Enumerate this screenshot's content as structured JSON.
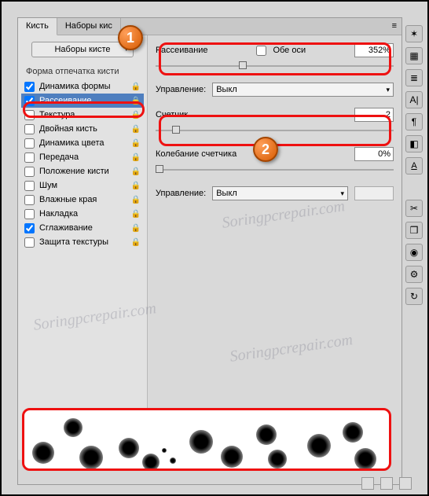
{
  "tabs": {
    "brush": "Кисть",
    "presets": "Наборы кис"
  },
  "presets_btn": "Наборы кисте",
  "section_title": "Форма отпечатка кисти",
  "options": [
    {
      "label": "Динамика формы",
      "checked": true
    },
    {
      "label": "Рассеивание",
      "checked": true,
      "selected": true
    },
    {
      "label": "Текстура",
      "checked": false
    },
    {
      "label": "Двойная кисть",
      "checked": false
    },
    {
      "label": "Динамика цвета",
      "checked": false
    },
    {
      "label": "Передача",
      "checked": false
    },
    {
      "label": "Положение кисти",
      "checked": false
    },
    {
      "label": "Шум",
      "checked": false
    },
    {
      "label": "Влажные края",
      "checked": false
    },
    {
      "label": "Накладка",
      "checked": false
    },
    {
      "label": "Сглаживание",
      "checked": true
    },
    {
      "label": "Защита текстуры",
      "checked": false
    }
  ],
  "right": {
    "scatter_label": "Рассеивание",
    "both_axes": "Обе оси",
    "scatter_value": "352%",
    "control_label": "Управление:",
    "control_value": "Выкл",
    "count_label": "Счетчик",
    "count_value": "2",
    "jitter_label": "Колебание счетчика",
    "jitter_value": "0%"
  },
  "callouts": {
    "c1": "1",
    "c2": "2"
  },
  "watermark": "Soringpcrepair.com"
}
